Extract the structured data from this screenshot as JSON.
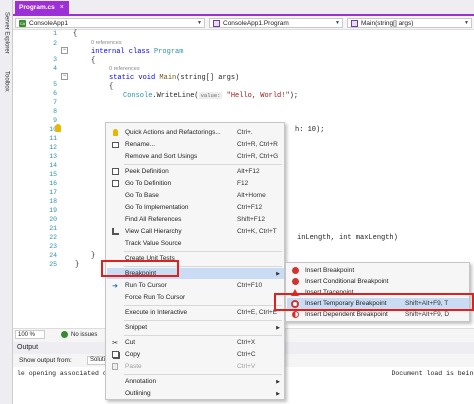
{
  "side_tabs": [
    "Server Explorer",
    "Toolbox"
  ],
  "editor_tab": {
    "title": "Program.cs",
    "close": "×"
  },
  "navbar": {
    "project": "ConsoleApp1",
    "class": "ConsoleApp1.Program",
    "member": "Main(string[] args)"
  },
  "line_numbers": [
    "1",
    "2",
    "3",
    "4",
    "5",
    "6",
    "7",
    "8",
    "9",
    "10",
    "11",
    "12",
    "13",
    "14",
    "15",
    "16",
    "17",
    "18",
    "19",
    "20",
    "21",
    "22",
    "23",
    "24",
    "25"
  ],
  "code": {
    "l2_brace": "{",
    "refs_0": "0 references",
    "l3_kw": "internal class ",
    "l3_type": "Program",
    "l4_brace": "{",
    "refs_1": "0 references",
    "l5_kw": "static void ",
    "l5_fn": "Main",
    "l5_rest": "(string[] args)",
    "l6_brace": "{",
    "l7_type": "Console",
    "l7_fn": ".WriteLine(",
    "l7_hint": "value:",
    "l7_str": "\"Hello, World!\"",
    "l7_end": ");",
    "l11_tail": "h: 10);",
    "l23_tail": "inLength, int maxLength)",
    "l24_brace": "}",
    "l25_brace": "}"
  },
  "context_menu": {
    "items": [
      {
        "label": "Quick Actions and Refactorings...",
        "shortcut": "Ctrl+.",
        "icon": "lightbulb-icon"
      },
      {
        "label": "Rename...",
        "shortcut": "Ctrl+R, Ctrl+R",
        "icon": "rename-icon"
      },
      {
        "label": "Remove and Sort Usings",
        "shortcut": "Ctrl+R, Ctrl+G",
        "icon": ""
      },
      {
        "label": "Peek Definition",
        "shortcut": "Alt+F12",
        "icon": "peek-icon"
      },
      {
        "label": "Go To Definition",
        "shortcut": "F12",
        "icon": "goto-definition-icon"
      },
      {
        "label": "Go To Base",
        "shortcut": "Alt+Home",
        "icon": ""
      },
      {
        "label": "Go To Implementation",
        "shortcut": "Ctrl+F12",
        "icon": ""
      },
      {
        "label": "Find All References",
        "shortcut": "Shift+F12",
        "icon": ""
      },
      {
        "label": "View Call Hierarchy",
        "shortcut": "Ctrl+K, Ctrl+T",
        "icon": "call-hierarchy-icon"
      },
      {
        "label": "Track Value Source",
        "shortcut": "",
        "icon": ""
      },
      {
        "label": "Create Unit Tests",
        "shortcut": "",
        "icon": ""
      },
      {
        "label": "Breakpoint",
        "shortcut": "",
        "icon": "",
        "submenu": true
      },
      {
        "label": "Run To Cursor",
        "shortcut": "Ctrl+F10",
        "icon": "run-to-cursor-icon"
      },
      {
        "label": "Force Run To Cursor",
        "shortcut": "",
        "icon": ""
      },
      {
        "label": "Execute in Interactive",
        "shortcut": "Ctrl+E, Ctrl+E",
        "icon": ""
      },
      {
        "label": "Snippet",
        "shortcut": "",
        "icon": "",
        "submenu": true
      },
      {
        "label": "Cut",
        "shortcut": "Ctrl+X",
        "icon": "cut-icon"
      },
      {
        "label": "Copy",
        "shortcut": "Ctrl+C",
        "icon": "copy-icon"
      },
      {
        "label": "Paste",
        "shortcut": "Ctrl+V",
        "icon": "paste-icon"
      },
      {
        "label": "Annotation",
        "shortcut": "",
        "icon": "",
        "submenu": true
      },
      {
        "label": "Outlining",
        "shortcut": "",
        "icon": "",
        "submenu": true
      }
    ]
  },
  "breakpoint_submenu": {
    "items": [
      {
        "label": "Insert Breakpoint",
        "shortcut": ""
      },
      {
        "label": "Insert Conditional Breakpoint",
        "shortcut": ""
      },
      {
        "label": "Insert Tracepoint",
        "shortcut": ""
      },
      {
        "label": "Insert Temporary Breakpoint",
        "shortcut": "Shift+Alt+F9, T"
      },
      {
        "label": "Insert Dependent Breakpoint",
        "shortcut": "Shift+Alt+F9, D"
      }
    ]
  },
  "status": {
    "zoom": "100 %",
    "issues": "No issues"
  },
  "output": {
    "title": "Output",
    "show_from_label": "Show output from:",
    "source": "Solution",
    "text": "le opening associated c                                                                         Document load is being skipped during this solu"
  },
  "colors": {
    "accent": "#9c2fd6",
    "highlight_box": "#e01f1f",
    "breakpoint": "#d1342f"
  }
}
